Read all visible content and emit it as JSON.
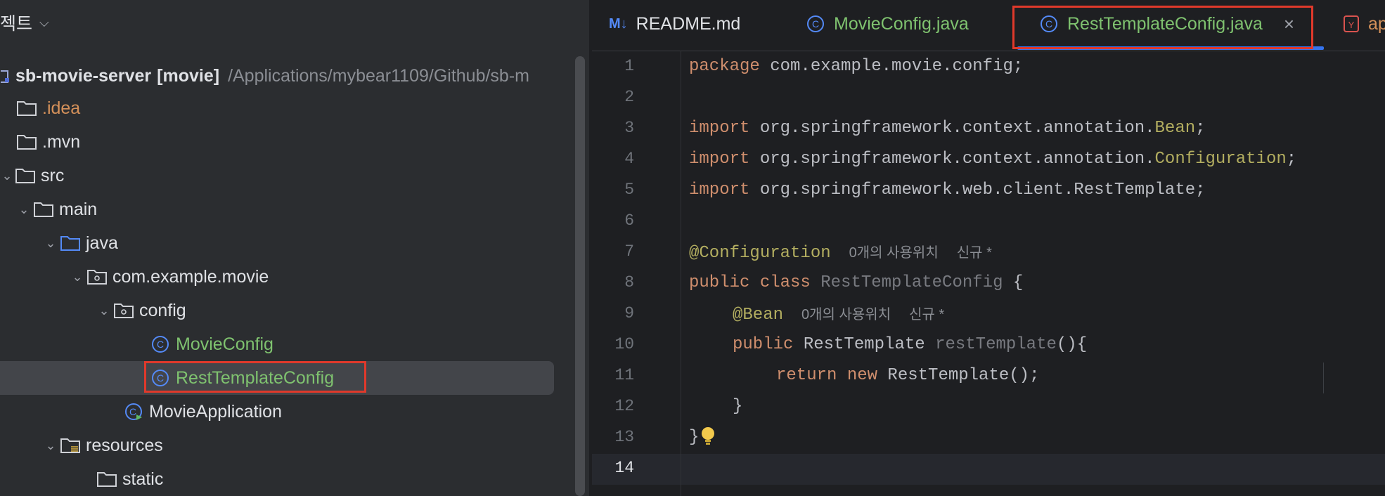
{
  "project": {
    "header_label": "젝트",
    "root_name": "sb-movie-server",
    "root_module": "[movie]",
    "root_path": "/Applications/mybear1109/Github/sb-m",
    "items": {
      "idea": ".idea",
      "mvn": ".mvn",
      "src": "src",
      "main": "main",
      "java": "java",
      "package": "com.example.movie",
      "config": "config",
      "movie_config": "MovieConfig",
      "rest_template_config": "RestTemplateConfig",
      "movie_application": "MovieApplication",
      "resources": "resources",
      "static": "static"
    }
  },
  "tabs": [
    {
      "icon": "M↓",
      "label": "README.md"
    },
    {
      "icon": "C",
      "label": "MovieConfig.java"
    },
    {
      "icon": "C",
      "label": "RestTemplateConfig.java",
      "close": "×"
    },
    {
      "icon": "Y",
      "label": "ap"
    }
  ],
  "editor": {
    "lines": [
      {
        "n": "1"
      },
      {
        "n": "2"
      },
      {
        "n": "3"
      },
      {
        "n": "4"
      },
      {
        "n": "5"
      },
      {
        "n": "6"
      },
      {
        "n": "7"
      },
      {
        "n": "8"
      },
      {
        "n": "9"
      },
      {
        "n": "10"
      },
      {
        "n": "11"
      },
      {
        "n": "12"
      },
      {
        "n": "13"
      },
      {
        "n": "14"
      }
    ],
    "code": {
      "l1_kw": "package",
      "l1_rest": " com.example.movie.config;",
      "l3_kw": "import",
      "l3_rest": " org.springframework.context.annotation.",
      "l3_cls": "Bean",
      "l3_end": ";",
      "l4_kw": "import",
      "l4_rest": " org.springframework.context.annotation.",
      "l4_cls": "Configuration",
      "l4_end": ";",
      "l5_kw": "import",
      "l5_rest": " org.springframework.web.client.RestTemplate;",
      "l7_ann": "@Configuration",
      "l7_hint1": "0개의 사용위치",
      "l7_hint2": "신규 *",
      "l8_kw": "public class",
      "l8_name": " RestTemplateConfig",
      "l8_rest": " {",
      "l9_ann": "@Bean",
      "l9_hint1": "0개의 사용위치",
      "l9_hint2": "신규 *",
      "l10_kw": "public",
      "l10_type": " RestTemplate ",
      "l10_method": "restTemplate",
      "l10_rest": "(){",
      "l11_kw": "return new",
      "l11_rest": " RestTemplate();",
      "l12": "}",
      "l13": "}"
    }
  },
  "colors": {
    "accent": "#3574f0",
    "highlight_box": "#e0392b",
    "bulb": "#f2c94c"
  }
}
